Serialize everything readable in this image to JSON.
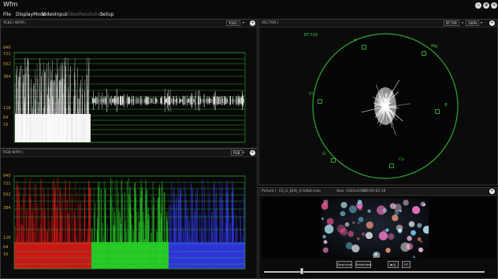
{
  "app": {
    "title": "Wfm"
  },
  "menu": {
    "items": [
      "File",
      "DisplayMode",
      "VideoInput",
      "VideoResolution",
      "Setup"
    ]
  },
  "window_controls": {
    "minimize": "−",
    "maximize": "⊕",
    "close": "×"
  },
  "ycbcr_panel": {
    "title": "YCbCr WFM |",
    "mode": "YCbCr",
    "ticks": [
      "940",
      "721",
      "502",
      "384",
      "128",
      "64",
      "16"
    ]
  },
  "rgb_panel": {
    "title": "RGB WFM |",
    "mode": "RGB",
    "ticks": [
      "940",
      "721",
      "502",
      "384",
      "128",
      "64",
      "16"
    ]
  },
  "vector_panel": {
    "title": "VECTOR |",
    "standard": "BT.709",
    "zoom": "100%",
    "overlay_label": "BT.709",
    "targets": [
      "R",
      "Mg",
      "B",
      "Cy",
      "G",
      "Yl"
    ]
  },
  "picture_panel": {
    "label": "Picture |",
    "filename": "CS_U_D(4)_A-10bit.mov",
    "size": "Size: 1920x1080",
    "timecode": "00:00:02:16"
  },
  "controls": {
    "downsize": "Downsize",
    "reset": "Resetview",
    "play": "▶/||",
    "fit": "FIT"
  },
  "playback": {
    "position": 0.17
  },
  "colors": {
    "grid": "#2fa82f",
    "tick": "#c6a233",
    "panel_bg": "#0b0b0b",
    "border": "#3a3a3a"
  }
}
